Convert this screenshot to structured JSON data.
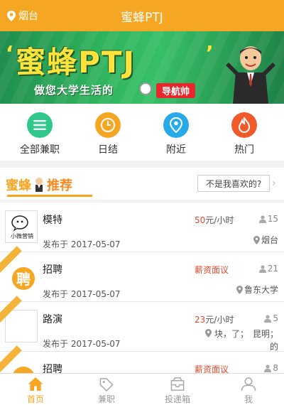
{
  "header": {
    "location": "烟台",
    "title": "蜜蜂PTJ"
  },
  "banner": {
    "headline": "蜜蜂PTJ",
    "quote_left": "‘",
    "quote_right": "’",
    "subtitle": "做您大学生活的",
    "tag": "导航帅"
  },
  "categories": [
    {
      "label": "全部兼职",
      "icon": "list-icon",
      "color": "#2fc88a"
    },
    {
      "label": "日结",
      "icon": "clock-icon",
      "color": "#f5a623"
    },
    {
      "label": "附近",
      "icon": "location-pin-icon",
      "color": "#28a9e8"
    },
    {
      "label": "热门",
      "icon": "flame-icon",
      "color": "#f05a28"
    }
  ],
  "recommend": {
    "brand_a": "蜜蜂",
    "brand_b": "推荐",
    "not_like": "不是我喜欢的?"
  },
  "jobs": [
    {
      "name": "模特",
      "date": "发布于 2017-05-07",
      "pay": "50",
      "pay_unit": "元/小时",
      "count": "15",
      "place": "烟台",
      "thumb_text": "小微营销"
    },
    {
      "name": "招聘",
      "date": "发布于 2017-05-07",
      "pay": "薪资面议",
      "pay_unit": "",
      "count": "21",
      "place": "鲁东大学",
      "thumb_text": ""
    },
    {
      "name": "路演",
      "date": "发布于 2017-05-07",
      "pay": "23",
      "pay_unit": "元/小时",
      "count": "5",
      "place": "块，了；　昆明；的",
      "thumb_text": ""
    },
    {
      "name": "招聘",
      "date": "",
      "pay": "薪资面议",
      "pay_unit": "",
      "count": "8",
      "place": "",
      "thumb_text": ""
    }
  ],
  "tabs": [
    {
      "label": "首页",
      "icon": "home-icon",
      "active": true
    },
    {
      "label": "兼职",
      "icon": "tag-icon",
      "active": false
    },
    {
      "label": "投递箱",
      "icon": "inbox-icon",
      "active": false
    },
    {
      "label": "我",
      "icon": "person-icon",
      "active": false
    }
  ],
  "colors": {
    "accent": "#f5a623",
    "price": "#e04a2f"
  }
}
